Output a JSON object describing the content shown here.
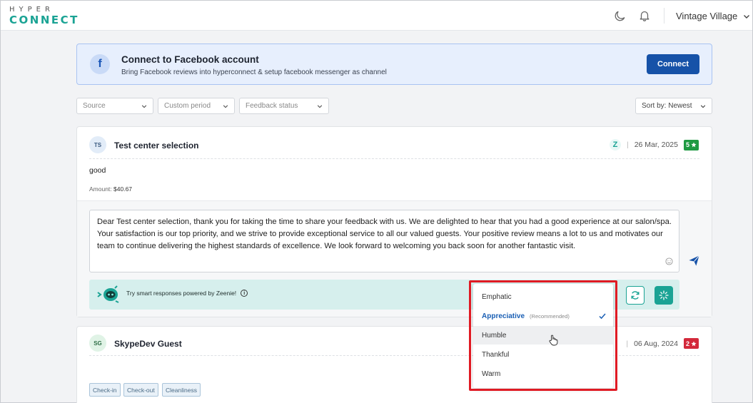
{
  "header": {
    "logo_line1": "HYPER",
    "logo_line2": "CONNECT",
    "account_name": "Vintage Village"
  },
  "facebook_banner": {
    "icon_letter": "f",
    "title": "Connect to Facebook account",
    "subtitle": "Bring Facebook reviews into hyperconnect & setup facebook messenger as channel",
    "button_label": "Connect"
  },
  "filters": {
    "source": "Source",
    "period": "Custom period",
    "status": "Feedback status",
    "sort": "Sort by: Newest"
  },
  "review1": {
    "initials": "TS",
    "name": "Test center selection",
    "source_badge": "Z",
    "date": "26 Mar, 2025",
    "rating": "5",
    "rating_color": "#1f9a43",
    "text": "good",
    "amount_label": "Amount:",
    "amount_value": "$40.67",
    "reply": "Dear Test center selection, thank you for taking the time to share your feedback with us. We are delighted to hear that you had a good experience at our salon/spa. Your satisfaction is our top priority, and we strive to provide exceptional service to all our valued guests. Your positive review means a lot to us and motivates our team to continue delivering the highest standards of excellence. We look forward to welcoming you back soon for another fantastic visit.",
    "zeenie_text": "Try smart responses powered by Zeenie!",
    "info_glyph": "i"
  },
  "review2": {
    "initials": "SG",
    "name": "SkypeDev Guest",
    "date": "06 Aug, 2024",
    "rating": "2",
    "rating_color": "#d3293b",
    "tags": [
      "Check-in",
      "Check-out",
      "Cleanliness"
    ]
  },
  "tone_menu": {
    "items": [
      {
        "label": "Emphatic"
      },
      {
        "label": "Appreciative",
        "note": "(Recommended)",
        "selected": true
      },
      {
        "label": "Humble",
        "hovered": true
      },
      {
        "label": "Thankful"
      },
      {
        "label": "Warm"
      }
    ]
  },
  "icons": [
    "moon-icon",
    "bell-icon",
    "chevron-down-icon",
    "facebook-icon",
    "send-icon",
    "emoji-icon",
    "refresh-icon",
    "sparkle-icon",
    "robot-icon",
    "info-icon",
    "check-icon",
    "star-icon",
    "hand-cursor-icon"
  ],
  "colors": {
    "accent": "#1aa394",
    "primary": "#1652a8",
    "highlight_outline": "#e01b24"
  }
}
